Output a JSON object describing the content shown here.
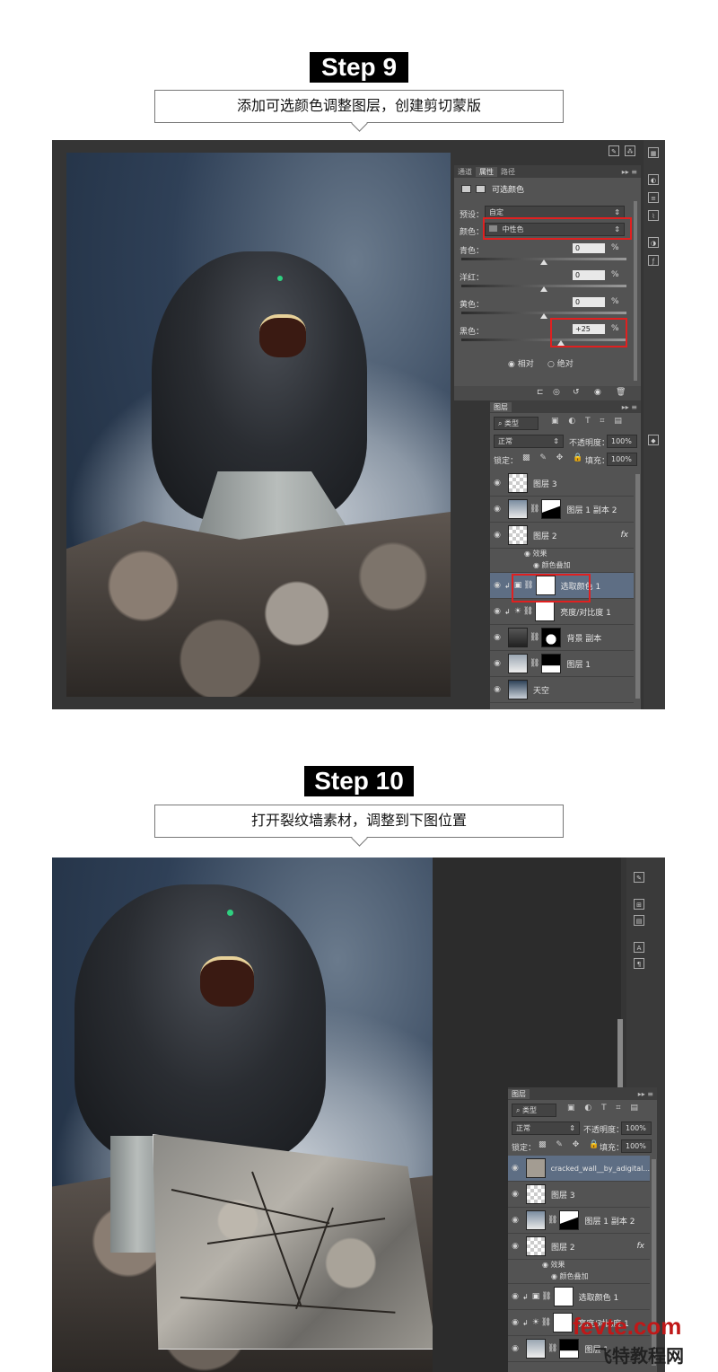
{
  "step9": {
    "badge": "Step 9",
    "caption": "添加可选颜色调整图层，创建剪切蒙版",
    "properties_panel": {
      "tabs": [
        "通道",
        "属性",
        "路径"
      ],
      "title": "可选颜色",
      "preset_label": "预设：",
      "preset_value": "自定",
      "colors_label": "颜色：",
      "colors_value": "中性色",
      "sliders": [
        {
          "label": "青色：",
          "value": "0",
          "unit": "%",
          "level": 0.5
        },
        {
          "label": "洋红：",
          "value": "0",
          "unit": "%",
          "level": 0.5
        },
        {
          "label": "黄色：",
          "value": "0",
          "unit": "%",
          "level": 0.5
        },
        {
          "label": "黑色：",
          "value": "+25",
          "unit": "%",
          "level": 0.625
        }
      ],
      "radio_relative": "相对",
      "radio_absolute": "绝对"
    },
    "layers_panel": {
      "tab": "图层",
      "filter": "类型",
      "blend_mode": "正常",
      "opacity_label": "不透明度：",
      "opacity_value": "100%",
      "lock_label": "锁定：",
      "fill_label": "填充：",
      "fill_value": "100%",
      "layers": [
        {
          "name": "图层 3"
        },
        {
          "name": "图层 1 副本 2"
        },
        {
          "name": "图层 2",
          "fx": "fx"
        },
        {
          "name": "效果",
          "sub": true
        },
        {
          "name": "颜色叠加",
          "sub": true
        },
        {
          "name": "选取颜色 1",
          "selected": true
        },
        {
          "name": "亮度/对比度 1"
        },
        {
          "name": "背景 副本"
        },
        {
          "name": "图层 1"
        },
        {
          "name": "天空"
        }
      ]
    }
  },
  "step10": {
    "badge": "Step 10",
    "caption": "打开裂纹墙素材，调整到下图位置",
    "layers_panel": {
      "tab": "图层",
      "filter": "类型",
      "blend_mode": "正常",
      "opacity_label": "不透明度：",
      "opacity_value": "100%",
      "lock_label": "锁定：",
      "fill_label": "填充：",
      "fill_value": "100%",
      "layers": [
        {
          "name": "cracked_wall__by_adigital...",
          "selected": true
        },
        {
          "name": "图层 3"
        },
        {
          "name": "图层 1 副本 2"
        },
        {
          "name": "图层 2",
          "fx": "fx"
        },
        {
          "name": "效果",
          "sub": true
        },
        {
          "name": "颜色叠加",
          "sub": true
        },
        {
          "name": "选取颜色 1"
        },
        {
          "name": "亮度/对比度 1"
        },
        {
          "name": "图层 1"
        }
      ]
    },
    "watermark_top": "fevte.com",
    "watermark_bottom": "飞特教程网"
  }
}
